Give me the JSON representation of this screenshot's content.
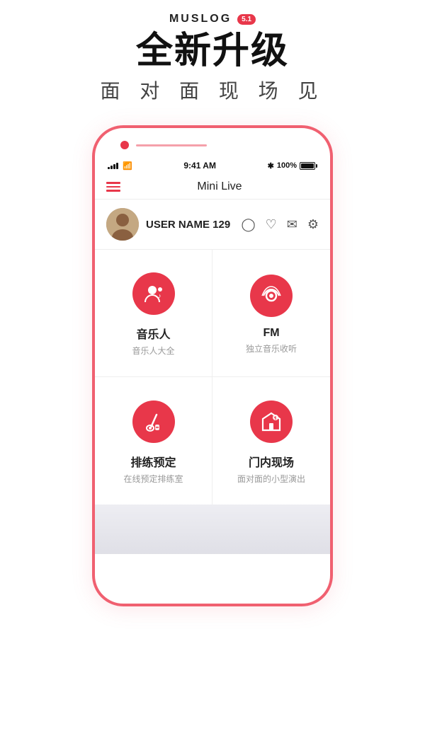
{
  "app": {
    "logo_text": "MUSLOG",
    "version": "5.1",
    "headline": "全新升级",
    "subheadline": "面 对 面   现 场 见"
  },
  "status_bar": {
    "time": "9:41 AM",
    "bluetooth": "✱",
    "battery_text": "100%"
  },
  "header": {
    "title": "Mini Live"
  },
  "user": {
    "name": "USER NAME 129"
  },
  "grid": [
    {
      "title": "音乐人",
      "subtitle": "音乐人大全",
      "icon": "person-music"
    },
    {
      "title": "FM",
      "subtitle": "独立音乐收听",
      "icon": "radio"
    },
    {
      "title": "排练预定",
      "subtitle": "在线预定排练室",
      "icon": "guitar"
    },
    {
      "title": "门内现场",
      "subtitle": "面对面的小型演出",
      "icon": "venue"
    }
  ],
  "colors": {
    "accent": "#e8374a",
    "text_primary": "#222222",
    "text_secondary": "#999999"
  }
}
